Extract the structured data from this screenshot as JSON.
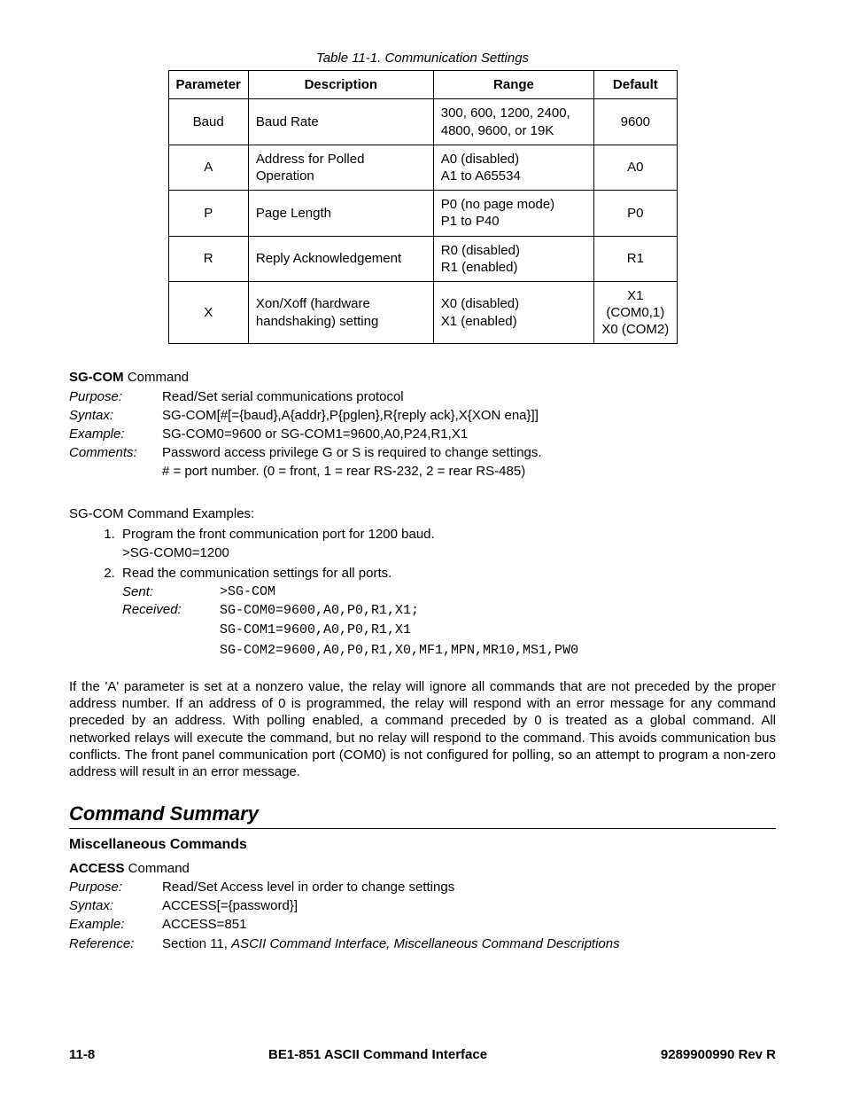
{
  "table": {
    "caption": "Table 11-1. Communication Settings",
    "headers": [
      "Parameter",
      "Description",
      "Range",
      "Default"
    ],
    "rows": [
      {
        "param": "Baud",
        "desc": "Baud Rate",
        "range": "300, 600, 1200, 2400, 4800, 9600, or 19K",
        "def": "9600"
      },
      {
        "param": "A",
        "desc": "Address for Polled Operation",
        "range": "A0 (disabled)\nA1 to A65534",
        "def": "A0"
      },
      {
        "param": "P",
        "desc": "Page Length",
        "range": "P0 (no page mode)\nP1 to P40",
        "def": "P0"
      },
      {
        "param": "R",
        "desc": "Reply Acknowledgement",
        "range": "R0 (disabled)\nR1 (enabled)",
        "def": "R1"
      },
      {
        "param": "X",
        "desc": "Xon/Xoff (hardware handshaking) setting",
        "range": "X0 (disabled)\nX1 (enabled)",
        "def": "X1 (COM0,1)\nX0 (COM2)"
      }
    ]
  },
  "sgcom": {
    "title_bold": "SG-COM",
    "title_rest": " Command",
    "purpose_label": "Purpose:",
    "purpose": "Read/Set serial communications protocol",
    "syntax_label": "Syntax:",
    "syntax": "SG-COM[#[={baud},A{addr},P{pglen},R{reply ack},X{XON ena}]]",
    "example_label": "Example:",
    "example": "SG-COM0=9600 or SG-COM1=9600,A0,P24,R1,X1",
    "comments_label": "Comments:",
    "comments1": "Password access privilege G or S is required to change settings.",
    "comments2": "# = port number. (0 = front, 1 = rear RS-232, 2 = rear RS-485)"
  },
  "examples": {
    "intro": "SG-COM Command Examples:",
    "item1": "Program the front communication port for 1200 baud.",
    "item1_code": ">SG-COM0=1200",
    "item2": "Read the communication settings for all ports.",
    "sent_label": "Sent:",
    "sent": ">SG-COM",
    "received_label": "Received:",
    "received1": "SG-COM0=9600,A0,P0,R1,X1;",
    "received2": "SG-COM1=9600,A0,P0,R1,X1",
    "received3": "SG-COM2=9600,A0,P0,R1,X0,MF1,MPN,MR10,MS1,PW0"
  },
  "body_para": "If the 'A' parameter is set at a nonzero value, the relay will ignore all commands that are not preceded by the proper address number. If an address of 0 is programmed, the relay will respond with an error message for any command preceded by an address. With polling enabled, a command preceded by 0 is treated as a global command. All networked relays will execute the command, but no relay will respond to the command. This avoids communication bus conflicts. The front panel communication port (COM0) is not configured for polling, so an attempt to program a non-zero address will result in an error message.",
  "summary_heading": "Command Summary",
  "misc_heading": "Miscellaneous Commands",
  "access": {
    "title_bold": "ACCESS",
    "title_rest": " Command",
    "purpose_label": "Purpose:",
    "purpose": "Read/Set Access level in order to change settings",
    "syntax_label": "Syntax:",
    "syntax": "ACCESS[={password}]",
    "example_label": "Example:",
    "example": "ACCESS=851",
    "reference_label": "Reference:",
    "reference_pre": "Section 11, ",
    "reference_ital": "ASCII Command Interface, Miscellaneous Command Descriptions"
  },
  "footer": {
    "left": "11-8",
    "center": "BE1-851 ASCII Command Interface",
    "right": "9289900990 Rev R"
  }
}
